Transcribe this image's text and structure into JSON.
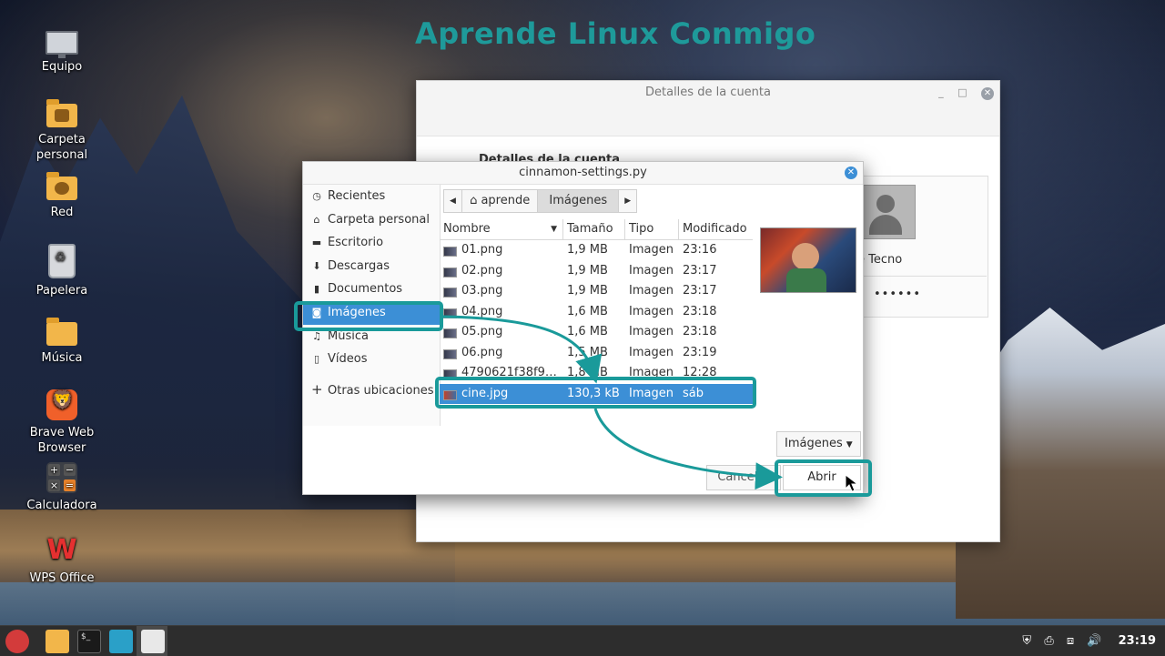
{
  "watermark": "Aprende Linux Conmigo",
  "desktop_icons": [
    {
      "label": "Equipo"
    },
    {
      "label": "Carpeta\npersonal"
    },
    {
      "label": "Red"
    },
    {
      "label": "Papelera"
    },
    {
      "label": "Música"
    },
    {
      "label": "Brave Web\nBrowser"
    },
    {
      "label": "Calculadora"
    },
    {
      "label": "WPS Office"
    }
  ],
  "background_window": {
    "title": "Detalles de la cuenta",
    "section": "Detalles de la cuenta",
    "name": "e Tecno",
    "password_mask": "••••••"
  },
  "dialog": {
    "title": "cinnamon-settings.py",
    "places": [
      {
        "label": "Recientes",
        "icon": "clock-icon"
      },
      {
        "label": "Carpeta personal",
        "icon": "home-icon"
      },
      {
        "label": "Escritorio",
        "icon": "desktop-icon"
      },
      {
        "label": "Descargas",
        "icon": "download-icon"
      },
      {
        "label": "Documentos",
        "icon": "document-icon"
      },
      {
        "label": "Imágenes",
        "icon": "camera-icon",
        "selected": true
      },
      {
        "label": "Música",
        "icon": "music-icon"
      },
      {
        "label": "Vídeos",
        "icon": "video-icon"
      },
      {
        "label": "Otras ubicaciones",
        "icon": "plus-icon"
      }
    ],
    "path": [
      "aprende",
      "Imágenes"
    ],
    "columns": [
      "Nombre",
      "Tamaño",
      "Tipo",
      "Modificado"
    ],
    "files": [
      {
        "name": "01.png",
        "size": "1,9 MB",
        "type": "Imagen",
        "modified": "23:16"
      },
      {
        "name": "02.png",
        "size": "1,9 MB",
        "type": "Imagen",
        "modified": "23:17"
      },
      {
        "name": "03.png",
        "size": "1,9 MB",
        "type": "Imagen",
        "modified": "23:17"
      },
      {
        "name": "04.png",
        "size": "1,6 MB",
        "type": "Imagen",
        "modified": "23:18"
      },
      {
        "name": "05.png",
        "size": "1,6 MB",
        "type": "Imagen",
        "modified": "23:18"
      },
      {
        "name": "06.png",
        "size": "1,5 MB",
        "type": "Imagen",
        "modified": "23:19"
      },
      {
        "name": "4790621f38f9…",
        "size": "1,8 MB",
        "type": "Imagen",
        "modified": "12:28"
      },
      {
        "name": "cine.jpg",
        "size": "130,3 kB",
        "type": "Imagen",
        "modified": "sáb",
        "selected": true
      }
    ],
    "filter": "Imágenes",
    "cancel_label": "Cancelar",
    "open_label": "Abrir"
  },
  "taskbar": {
    "clock": "23:19"
  },
  "colors": {
    "accent": "#3c8fd6",
    "annotation": "#1a9a9a"
  }
}
